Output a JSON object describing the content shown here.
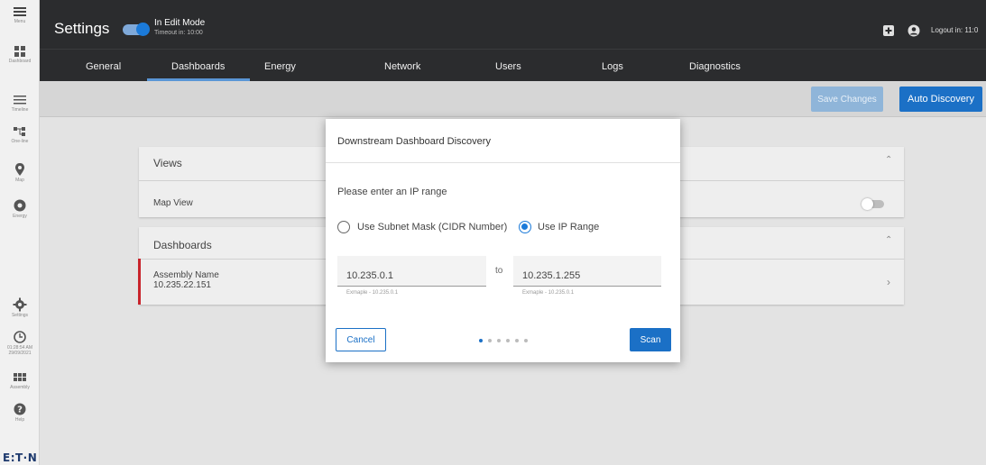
{
  "rail": {
    "items": [
      {
        "name": "menu",
        "caption": "Menu"
      },
      {
        "name": "dashboard",
        "caption": "Dashboard"
      },
      {
        "name": "timeline",
        "caption": "Timeline"
      },
      {
        "name": "one-line",
        "caption": "One-line"
      },
      {
        "name": "map",
        "caption": "Map"
      },
      {
        "name": "energy",
        "caption": "Energy"
      },
      {
        "name": "settings",
        "caption": "Settings"
      },
      {
        "name": "clock",
        "caption": "01:28:54 AM 29/09/2021"
      },
      {
        "name": "assembly",
        "caption": "Assembly"
      },
      {
        "name": "help",
        "caption": "Help"
      }
    ],
    "brand": "E:T·N"
  },
  "header": {
    "title": "Settings",
    "mode_title": "In Edit Mode",
    "mode_timeout": "Timeout in: 10:00",
    "logout": "Logout in: 11:0"
  },
  "tabs": [
    "General",
    "Dashboards",
    "Energy",
    "Network",
    "Users",
    "Logs",
    "Diagnostics"
  ],
  "active_tab": "Dashboards",
  "toolbar": {
    "save_label": "Save Changes",
    "auto_label": "Auto Discovery"
  },
  "cards": {
    "views_title": "Views",
    "map_view_label": "Map View",
    "map_view_enabled": false,
    "dashboards_title": "Dashboards",
    "assembly_name": "Assembly Name",
    "assembly_ip": "10.235.22.151"
  },
  "modal": {
    "title": "Downstream Dashboard Discovery",
    "prompt": "Please enter an IP range",
    "option_subnet": "Use Subnet Mask (CIDR Number)",
    "option_range": "Use IP Range",
    "selected_option": "Use IP Range",
    "from_value": "10.235.0.1",
    "to_label": "to",
    "to_value": "10.235.1.255",
    "from_hint": "Exmaple - 10.235.0.1",
    "to_hint": "Exmaple - 10.235.0.1",
    "cancel_label": "Cancel",
    "scan_label": "Scan",
    "pager_total": 6,
    "pager_active": 1
  },
  "colors": {
    "accent": "#1b70c6",
    "header_bg": "#2b2c2e",
    "alert_red": "#c8232b"
  }
}
